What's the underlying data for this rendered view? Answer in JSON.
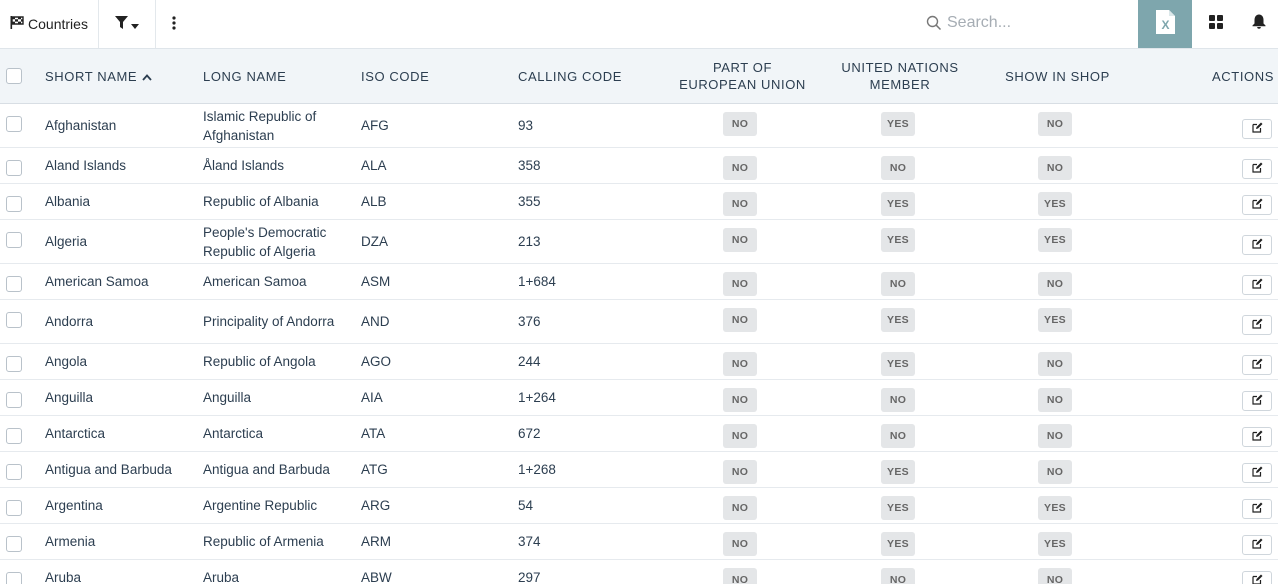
{
  "toolbar": {
    "countries_label": "Countries",
    "search_placeholder": "Search...",
    "excel_letter": "X"
  },
  "columns": {
    "short_name": "SHORT NAME",
    "long_name": "LONG NAME",
    "iso_code": "ISO CODE",
    "calling_code": "CALLING CODE",
    "eu_line1": "PART OF",
    "eu_line2": "EUROPEAN UNION",
    "un_line1": "UNITED NATIONS",
    "un_line2": "MEMBER",
    "show_in_shop": "SHOW IN SHOP",
    "actions": "ACTIONS"
  },
  "rows": [
    {
      "short": "Afghanistan",
      "long": "Islamic Republic of Afghanistan",
      "iso": "AFG",
      "calling": "93",
      "eu": "NO",
      "un": "YES",
      "shop": "NO"
    },
    {
      "short": "Aland Islands",
      "long": "Åland Islands",
      "iso": "ALA",
      "calling": "358",
      "eu": "NO",
      "un": "NO",
      "shop": "NO"
    },
    {
      "short": "Albania",
      "long": "Republic of Albania",
      "iso": "ALB",
      "calling": "355",
      "eu": "NO",
      "un": "YES",
      "shop": "YES"
    },
    {
      "short": "Algeria",
      "long": "People's Democratic Republic of Algeria",
      "iso": "DZA",
      "calling": "213",
      "eu": "NO",
      "un": "YES",
      "shop": "YES"
    },
    {
      "short": "American Samoa",
      "long": "American Samoa",
      "iso": "ASM",
      "calling": "1+684",
      "eu": "NO",
      "un": "NO",
      "shop": "NO"
    },
    {
      "short": "Andorra",
      "long": "Principality of Andorra",
      "iso": "AND",
      "calling": "376",
      "eu": "NO",
      "un": "YES",
      "shop": "YES"
    },
    {
      "short": "Angola",
      "long": "Republic of Angola",
      "iso": "AGO",
      "calling": "244",
      "eu": "NO",
      "un": "YES",
      "shop": "NO"
    },
    {
      "short": "Anguilla",
      "long": "Anguilla",
      "iso": "AIA",
      "calling": "1+264",
      "eu": "NO",
      "un": "NO",
      "shop": "NO"
    },
    {
      "short": "Antarctica",
      "long": "Antarctica",
      "iso": "ATA",
      "calling": "672",
      "eu": "NO",
      "un": "NO",
      "shop": "NO"
    },
    {
      "short": "Antigua and Barbuda",
      "long": "Antigua and Barbuda",
      "iso": "ATG",
      "calling": "1+268",
      "eu": "NO",
      "un": "YES",
      "shop": "NO"
    },
    {
      "short": "Argentina",
      "long": "Argentine Republic",
      "iso": "ARG",
      "calling": "54",
      "eu": "NO",
      "un": "YES",
      "shop": "YES"
    },
    {
      "short": "Armenia",
      "long": "Republic of Armenia",
      "iso": "ARM",
      "calling": "374",
      "eu": "NO",
      "un": "YES",
      "shop": "YES"
    },
    {
      "short": "Aruba",
      "long": "Aruba",
      "iso": "ABW",
      "calling": "297",
      "eu": "NO",
      "un": "NO",
      "shop": "NO"
    }
  ],
  "colors": {
    "excel_button": "#7ea6ad",
    "header_bg": "#f1f5f8",
    "badge_bg": "#e4e6e8"
  },
  "icons": {
    "countries": "flag-icon",
    "filter": "filter-icon",
    "more": "kebab-menu-icon",
    "search": "search-icon",
    "excel": "excel-file-icon",
    "grid": "grid-icon",
    "bell": "bell-icon",
    "sort": "sort-ascending-icon",
    "edit": "edit-icon"
  }
}
